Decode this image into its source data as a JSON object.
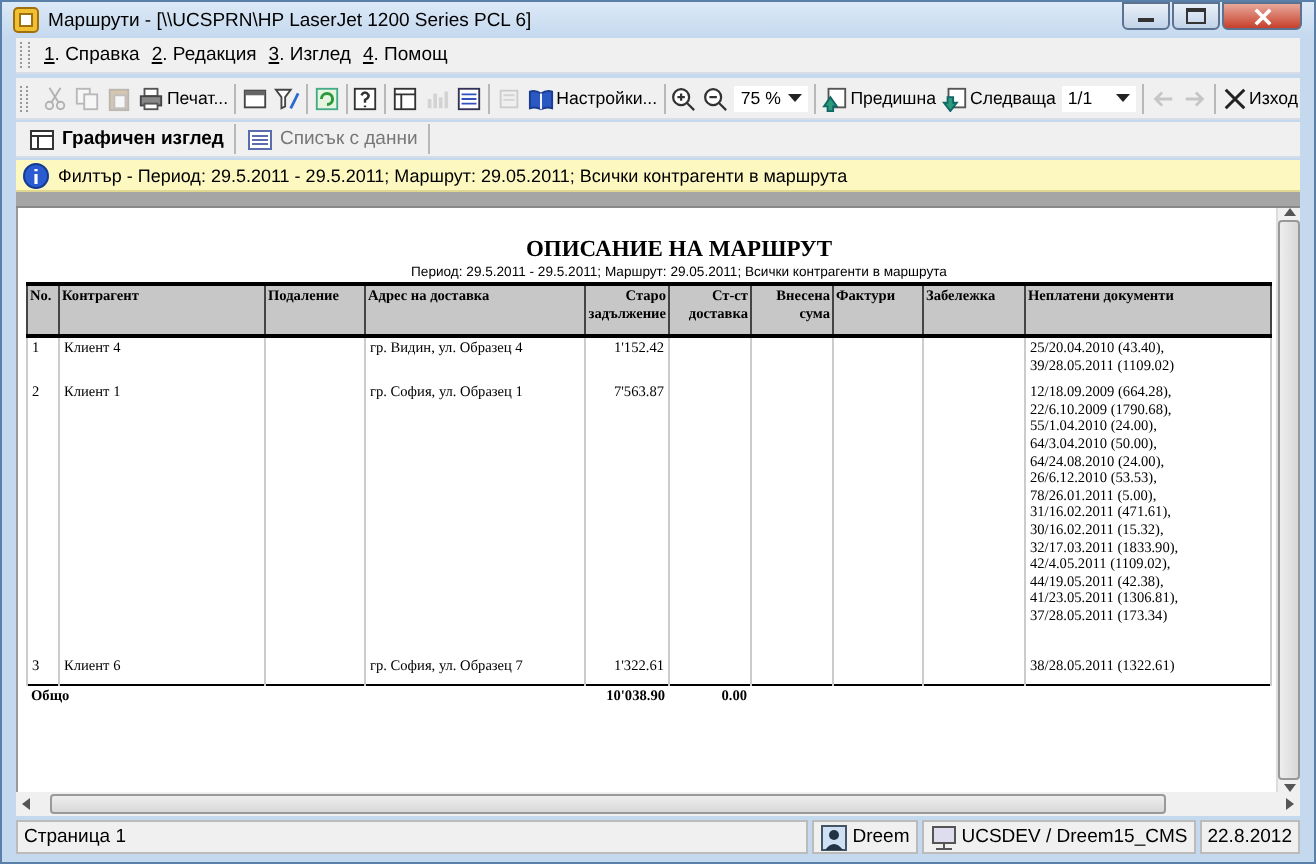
{
  "window": {
    "title": "Маршрути - [\\\\UCSPRN\\HP LaserJet 1200 Series PCL 6]"
  },
  "menu": [
    {
      "label": "1. Справка"
    },
    {
      "label": "2. Редакция"
    },
    {
      "label": "3. Изглед"
    },
    {
      "label": "4. Помощ"
    }
  ],
  "toolbar": [
    {
      "kind": "icon",
      "disabled": true
    },
    {
      "kind": "icon",
      "disabled": true
    },
    {
      "kind": "icon",
      "disabled": true
    },
    {
      "kind": "button",
      "label": "Печат...",
      "disabled": false
    },
    {
      "kind": "separator"
    },
    {
      "kind": "icon",
      "disabled": false
    },
    {
      "kind": "icon",
      "disabled": false
    },
    {
      "kind": "separator"
    },
    {
      "kind": "icon",
      "disabled": false
    },
    {
      "kind": "separator"
    },
    {
      "kind": "icon",
      "disabled": false
    },
    {
      "kind": "separator"
    },
    {
      "kind": "icon",
      "disabled": false
    },
    {
      "kind": "icon",
      "disabled": true
    },
    {
      "kind": "icon",
      "disabled": false
    },
    {
      "kind": "separator"
    },
    {
      "kind": "icon",
      "disabled": true
    },
    {
      "kind": "button",
      "label": "Настройки...",
      "disabled": false
    },
    {
      "kind": "separator"
    },
    {
      "kind": "icon",
      "disabled": false
    },
    {
      "kind": "icon",
      "disabled": false
    },
    {
      "kind": "dropdown",
      "value": "75 %"
    },
    {
      "kind": "separator"
    },
    {
      "kind": "button",
      "label": "Предишна",
      "disabled": false
    },
    {
      "kind": "button",
      "label": "Следваща",
      "disabled": false
    },
    {
      "kind": "dropdown",
      "value": "1/1"
    },
    {
      "kind": "separator"
    },
    {
      "kind": "icon",
      "disabled": true
    },
    {
      "kind": "icon",
      "disabled": true
    },
    {
      "kind": "separator"
    },
    {
      "kind": "button",
      "label": "Изход",
      "disabled": false
    }
  ],
  "tabs": [
    {
      "label": "Графичен изглед",
      "selected": true
    },
    {
      "label": "Списък с данни",
      "selected": false
    }
  ],
  "filter_bar": {
    "text": "Филтър - Период: 29.5.2011 - 29.5.2011; Маршрут: 29.05.2011; Всички контрагенти в маршрута"
  },
  "report": {
    "title": "ОПИСАНИЕ НА МАРШРУТ",
    "subtitle": "Период: 29.5.2011 - 29.5.2011; Маршрут: 29.05.2011; Всички контрагенти в маршрута",
    "columns": [
      "No.",
      "Контрагент",
      "Подаление",
      "Адрес на доставка",
      "Старо задължение",
      "Ст-ст доставка",
      "Внесена сума",
      "Фактури",
      "Забележка",
      "Неплатени документи"
    ],
    "rows": [
      {
        "no": "1",
        "client": "Клиент 4",
        "address": "гр. Видин, ул. Образец 4",
        "old_debt": "1'152.42",
        "unpaid_documents": [
          "25/20.04.2010 (43.40),",
          "39/28.05.2011 (1109.02)"
        ]
      },
      {
        "no": "2",
        "client": "Клиент 1",
        "address": "гр. София, ул. Образец 1",
        "old_debt": "7'563.87",
        "unpaid_documents": [
          "12/18.09.2009 (664.28),",
          "22/6.10.2009 (1790.68),",
          "55/1.04.2010 (24.00),",
          "64/3.04.2010 (50.00),",
          "64/24.08.2010 (24.00),",
          "26/6.12.2010 (53.53),",
          "78/26.01.2011 (5.00),",
          "31/16.02.2011 (471.61),",
          "30/16.02.2011 (15.32),",
          "32/17.03.2011 (1833.90),",
          "42/4.05.2011 (1109.02),",
          "44/19.05.2011 (42.38),",
          "41/23.05.2011 (1306.81),",
          "37/28.05.2011 (173.34)"
        ]
      },
      {
        "no": "3",
        "client": "Клиент 6",
        "address": "гр. София, ул. Образец 7",
        "old_debt": "1'322.61",
        "unpaid_documents": [
          "38/28.05.2011 (1322.61)"
        ]
      }
    ],
    "totals": {
      "label": "Общо",
      "old_debt": "10'038.90",
      "delivery_cost": "0.00"
    }
  },
  "status_bar": {
    "page": "Страница 1",
    "user": "Dreem",
    "database": "UCSDEV / Dreem15_CMS",
    "date": "22.8.2012"
  }
}
